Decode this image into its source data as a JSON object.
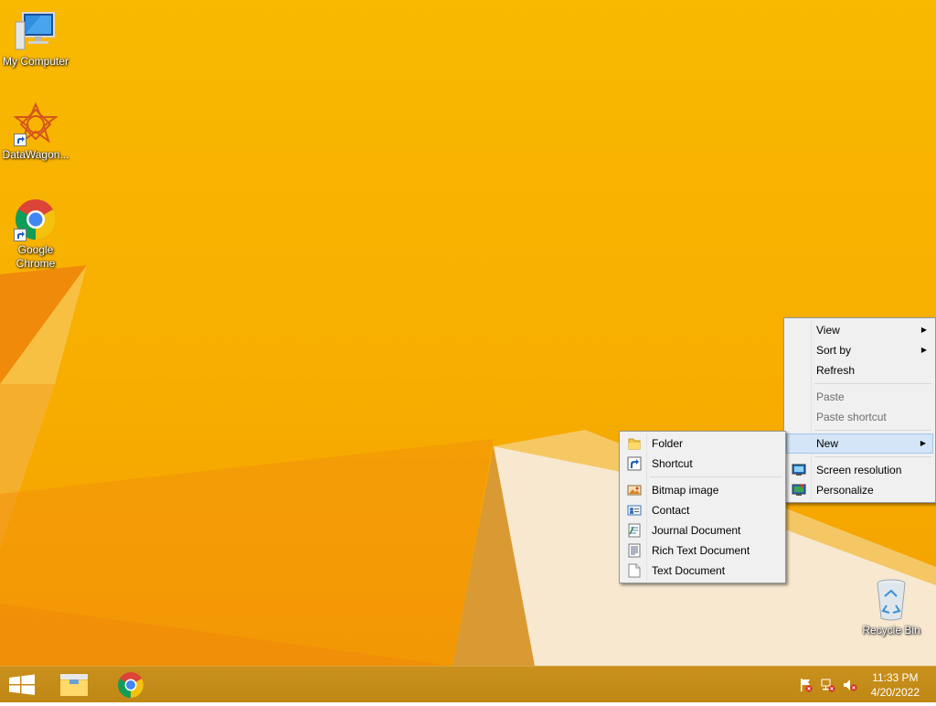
{
  "desktop": {
    "icons": [
      {
        "label": "My Computer",
        "icon": "computer-icon"
      },
      {
        "label": "DataWagon...",
        "icon": "datawagon-icon"
      },
      {
        "label": "Google Chrome",
        "icon": "chrome-icon"
      },
      {
        "label": "Recycle Bin",
        "icon": "recycle-bin-icon"
      }
    ]
  },
  "context_menu": {
    "view": "View",
    "sort_by": "Sort by",
    "refresh": "Refresh",
    "paste": "Paste",
    "paste_shortcut": "Paste shortcut",
    "new": "New",
    "screen_resolution": "Screen resolution",
    "personalize": "Personalize"
  },
  "new_submenu": {
    "folder": "Folder",
    "shortcut": "Shortcut",
    "bitmap_image": "Bitmap image",
    "contact": "Contact",
    "journal_document": "Journal Document",
    "rich_text_document": "Rich Text Document",
    "text_document": "Text Document"
  },
  "taskbar": {
    "time": "11:33 PM",
    "date": "4/20/2022"
  },
  "colors": {
    "wallpaper": "#f9b900",
    "taskbar": "#c48a16",
    "menu_hover": "#d4e5f7"
  }
}
